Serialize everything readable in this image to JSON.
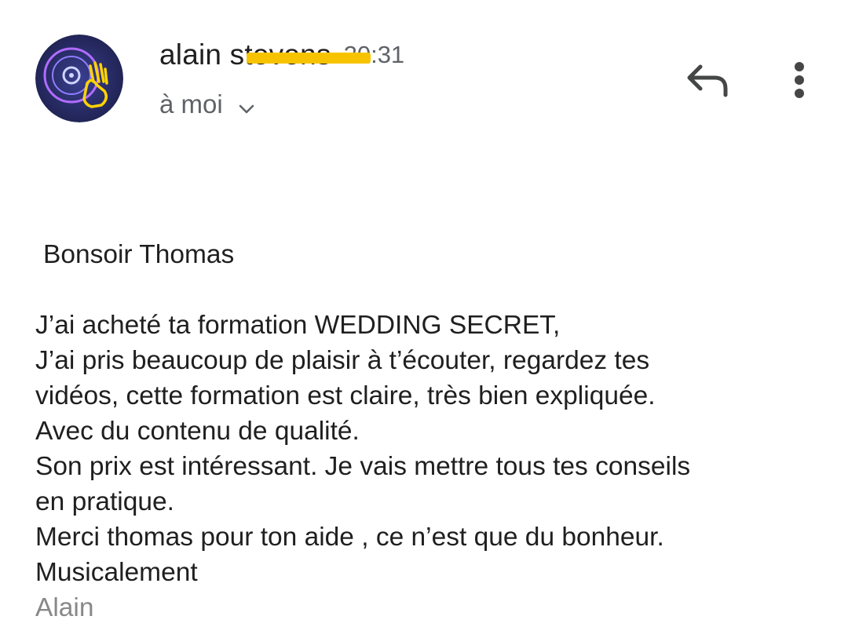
{
  "header": {
    "sender_first": "alain",
    "sender_last": "stevens",
    "time": "20:31",
    "recipient_label": "à moi"
  },
  "icons": {
    "avatar": "dj-record-hand-avatar",
    "reply": "reply-icon",
    "more": "more-vert-icon",
    "expand": "chevron-down-icon"
  },
  "colors": {
    "redaction": "#f7c300",
    "secondary_text": "#5f6368",
    "signature": "#888888"
  },
  "message": {
    "greeting": " Bonsoir Thomas",
    "lines": [
      "J’ai acheté ta formation WEDDING SECRET,",
      "J’ai pris beaucoup de plaisir à t’écouter, regardez tes",
      "vidéos, cette formation est claire, très bien expliquée.",
      "Avec du contenu de qualité.",
      "Son prix est intéressant. Je vais mettre tous tes conseils",
      "en pratique.",
      "Merci thomas pour ton aide , ce n’est que du bonheur.",
      "Musicalement"
    ],
    "signature": "Alain"
  }
}
